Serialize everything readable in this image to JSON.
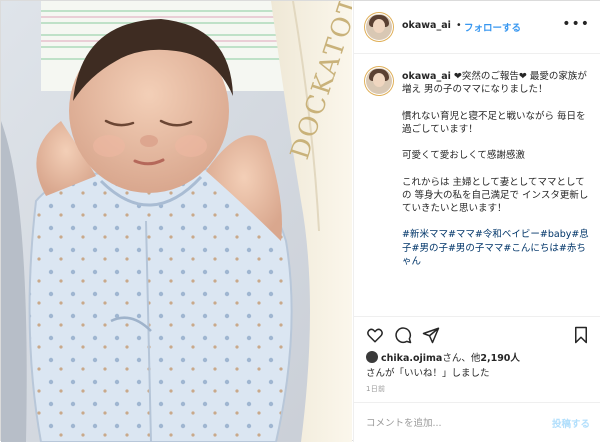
{
  "post": {
    "username": "okawa_ai",
    "separator": "•",
    "follow_label": "フォローする",
    "more_label": "•••"
  },
  "photo": {
    "pillow_text": "DOCKATOT"
  },
  "caption": {
    "username": "okawa_ai",
    "paragraphs": [
      "❤突然のご報告❤ 最愛の家族が増え 男の子のママになりました！",
      "慣れない育児と寝不足と戦いながら 毎日を過ごしています！",
      "可愛くて愛おしくて感謝感激",
      "これからは 主婦として妻としてママとしての 等身大の私を自己満足で インスタ更新していきたいと思います！"
    ],
    "hashtags": "#新米ママ#ママ#令和ベイビー#baby#息子#男の子#男の子ママ#こんにちは#赤ちゃん"
  },
  "actions": {
    "icons": [
      "heart-icon",
      "comment-icon",
      "share-icon",
      "bookmark-icon"
    ]
  },
  "likes": {
    "user": "chika.ojima",
    "text_mid": "さん、他",
    "count": "2,190人",
    "text_end": "さんが「いいね！」しました"
  },
  "timestamp": "1日前",
  "comment": {
    "placeholder": "コメントを追加...",
    "post_label": "投稿する"
  },
  "colors": {
    "link_blue": "#3897f0",
    "hashtag_blue": "#003569",
    "text": "#262626",
    "muted": "#999999",
    "post_disabled": "#b2dffc"
  }
}
